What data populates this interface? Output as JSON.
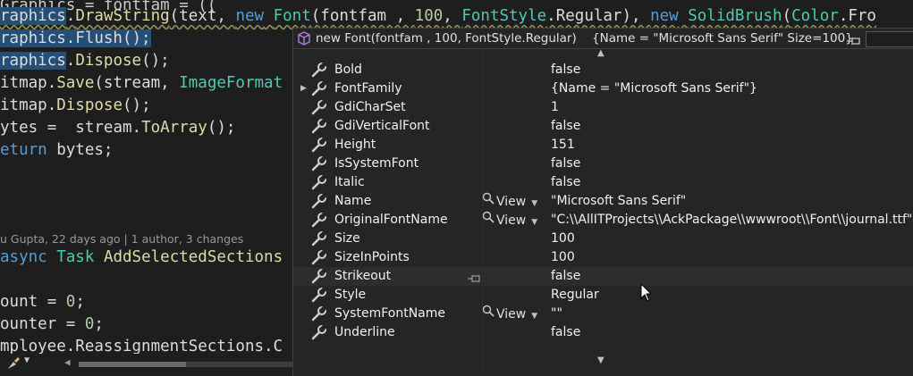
{
  "editor": {
    "lines": [
      {
        "id": "partial-top",
        "segments": [
          {
            "t": "Graphics ",
            "c": ""
          },
          {
            "t": "=",
            "c": ""
          },
          {
            "t": " fontfam ",
            "c": ""
          },
          {
            "t": "= ((",
            "c": ""
          }
        ]
      },
      {
        "id": "draw-string",
        "segments": [
          {
            "t": "raphics",
            "c": "hl"
          },
          {
            "t": ".",
            "c": ""
          },
          {
            "t": "DrawString",
            "c": "method"
          },
          {
            "t": "(text, ",
            "c": ""
          },
          {
            "t": "new",
            "c": "kw"
          },
          {
            "t": " ",
            "c": ""
          },
          {
            "t": "Font",
            "c": "ty"
          },
          {
            "t": "(fontfam , ",
            "c": ""
          },
          {
            "t": "100",
            "c": "num"
          },
          {
            "t": ", ",
            "c": ""
          },
          {
            "t": "FontStyle",
            "c": "ty"
          },
          {
            "t": ".Regular), ",
            "c": ""
          },
          {
            "t": "new",
            "c": "kw"
          },
          {
            "t": " ",
            "c": ""
          },
          {
            "t": "SolidBrush",
            "c": "ty"
          },
          {
            "t": "(",
            "c": ""
          },
          {
            "t": "Color",
            "c": "ty"
          },
          {
            "t": ".Fro",
            "c": ""
          }
        ]
      },
      {
        "id": "flush",
        "segments": [
          {
            "t": "raphics.Flush();",
            "c": "hl"
          }
        ]
      },
      {
        "id": "dispose-g",
        "segments": [
          {
            "t": "raphics",
            "c": "hl"
          },
          {
            "t": ".",
            "c": ""
          },
          {
            "t": "Dispose",
            "c": "method"
          },
          {
            "t": "();",
            "c": ""
          }
        ]
      },
      {
        "id": "save",
        "segments": [
          {
            "t": "itmap",
            "c": ""
          },
          {
            "t": ".",
            "c": ""
          },
          {
            "t": "Save",
            "c": "method"
          },
          {
            "t": "(stream, ",
            "c": ""
          },
          {
            "t": "ImageFormat",
            "c": "ty"
          }
        ]
      },
      {
        "id": "dispose-b",
        "segments": [
          {
            "t": "itmap",
            "c": ""
          },
          {
            "t": ".",
            "c": ""
          },
          {
            "t": "Dispose",
            "c": "method"
          },
          {
            "t": "();",
            "c": ""
          }
        ]
      },
      {
        "id": "bytes",
        "segments": [
          {
            "t": "ytes",
            "c": ""
          },
          {
            "t": " =  stream.",
            "c": ""
          },
          {
            "t": "ToArray",
            "c": "method"
          },
          {
            "t": "();",
            "c": ""
          }
        ]
      },
      {
        "id": "return",
        "segments": [
          {
            "t": "eturn",
            "c": "kw"
          },
          {
            "t": " bytes;",
            "c": ""
          }
        ]
      },
      {
        "id": "blank1",
        "segments": []
      },
      {
        "id": "blank2",
        "segments": []
      },
      {
        "id": "method-decl",
        "segments": [
          {
            "t": "async",
            "c": "kw"
          },
          {
            "t": " ",
            "c": ""
          },
          {
            "t": "Task",
            "c": "ty"
          },
          {
            "t": " ",
            "c": ""
          },
          {
            "t": "AddSelectedSections",
            "c": "method"
          }
        ]
      },
      {
        "id": "blank3",
        "segments": []
      },
      {
        "id": "count",
        "segments": [
          {
            "t": "ount",
            "c": ""
          },
          {
            "t": " = ",
            "c": ""
          },
          {
            "t": "0",
            "c": "num"
          },
          {
            "t": ";",
            "c": ""
          }
        ]
      },
      {
        "id": "counter",
        "segments": [
          {
            "t": "ounter",
            "c": ""
          },
          {
            "t": " = ",
            "c": ""
          },
          {
            "t": "0",
            "c": "num"
          },
          {
            "t": ";",
            "c": ""
          }
        ]
      },
      {
        "id": "employee",
        "segments": [
          {
            "t": "mployee",
            "c": ""
          },
          {
            "t": ".ReassignmentSections.C",
            "c": ""
          }
        ]
      }
    ],
    "codelens": "u Gupta, 22 days ago | 1 author, 3 changes"
  },
  "datatip": {
    "expression": "new Font(fontfam , 100, FontStyle.Regular)",
    "summary": "{Name = \"Microsoft Sans Serif\" Size=100}",
    "rows": [
      {
        "name": "Bold",
        "value": "false",
        "expandable": false,
        "viewer": ""
      },
      {
        "name": "FontFamily",
        "value": "{Name = \"Microsoft Sans Serif\"}",
        "expandable": true,
        "viewer": ""
      },
      {
        "name": "GdiCharSet",
        "value": "1",
        "expandable": false,
        "viewer": ""
      },
      {
        "name": "GdiVerticalFont",
        "value": "false",
        "expandable": false,
        "viewer": ""
      },
      {
        "name": "Height",
        "value": "151",
        "expandable": false,
        "viewer": ""
      },
      {
        "name": "IsSystemFont",
        "value": "false",
        "expandable": false,
        "viewer": ""
      },
      {
        "name": "Italic",
        "value": "false",
        "expandable": false,
        "viewer": ""
      },
      {
        "name": "Name",
        "value": "\"Microsoft Sans Serif\"",
        "expandable": false,
        "viewer": "View"
      },
      {
        "name": "OriginalFontName",
        "value": "\"C:\\\\AllITProjects\\\\AckPackage\\\\wwwroot\\\\Font\\\\journal.ttf\"",
        "expandable": false,
        "viewer": "View"
      },
      {
        "name": "Size",
        "value": "100",
        "expandable": false,
        "viewer": ""
      },
      {
        "name": "SizeInPoints",
        "value": "100",
        "expandable": false,
        "viewer": ""
      },
      {
        "name": "Strikeout",
        "value": "false",
        "expandable": false,
        "viewer": "",
        "selected": true
      },
      {
        "name": "Style",
        "value": "Regular",
        "expandable": false,
        "viewer": ""
      },
      {
        "name": "SystemFontName",
        "value": "\"\"",
        "expandable": false,
        "viewer": "View"
      },
      {
        "name": "Underline",
        "value": "false",
        "expandable": false,
        "viewer": ""
      }
    ]
  },
  "colors": {
    "editor_bg": "#1e1e1e",
    "tip_bg": "#252526",
    "keyword": "#569cd6",
    "type": "#4ec9b0",
    "method": "#dcdcaa",
    "selection": "#264f78"
  },
  "icons": {
    "property": "wrench-icon",
    "object": "cube-icon",
    "viewer": "magnifier-icon",
    "pin": "pin-icon"
  }
}
